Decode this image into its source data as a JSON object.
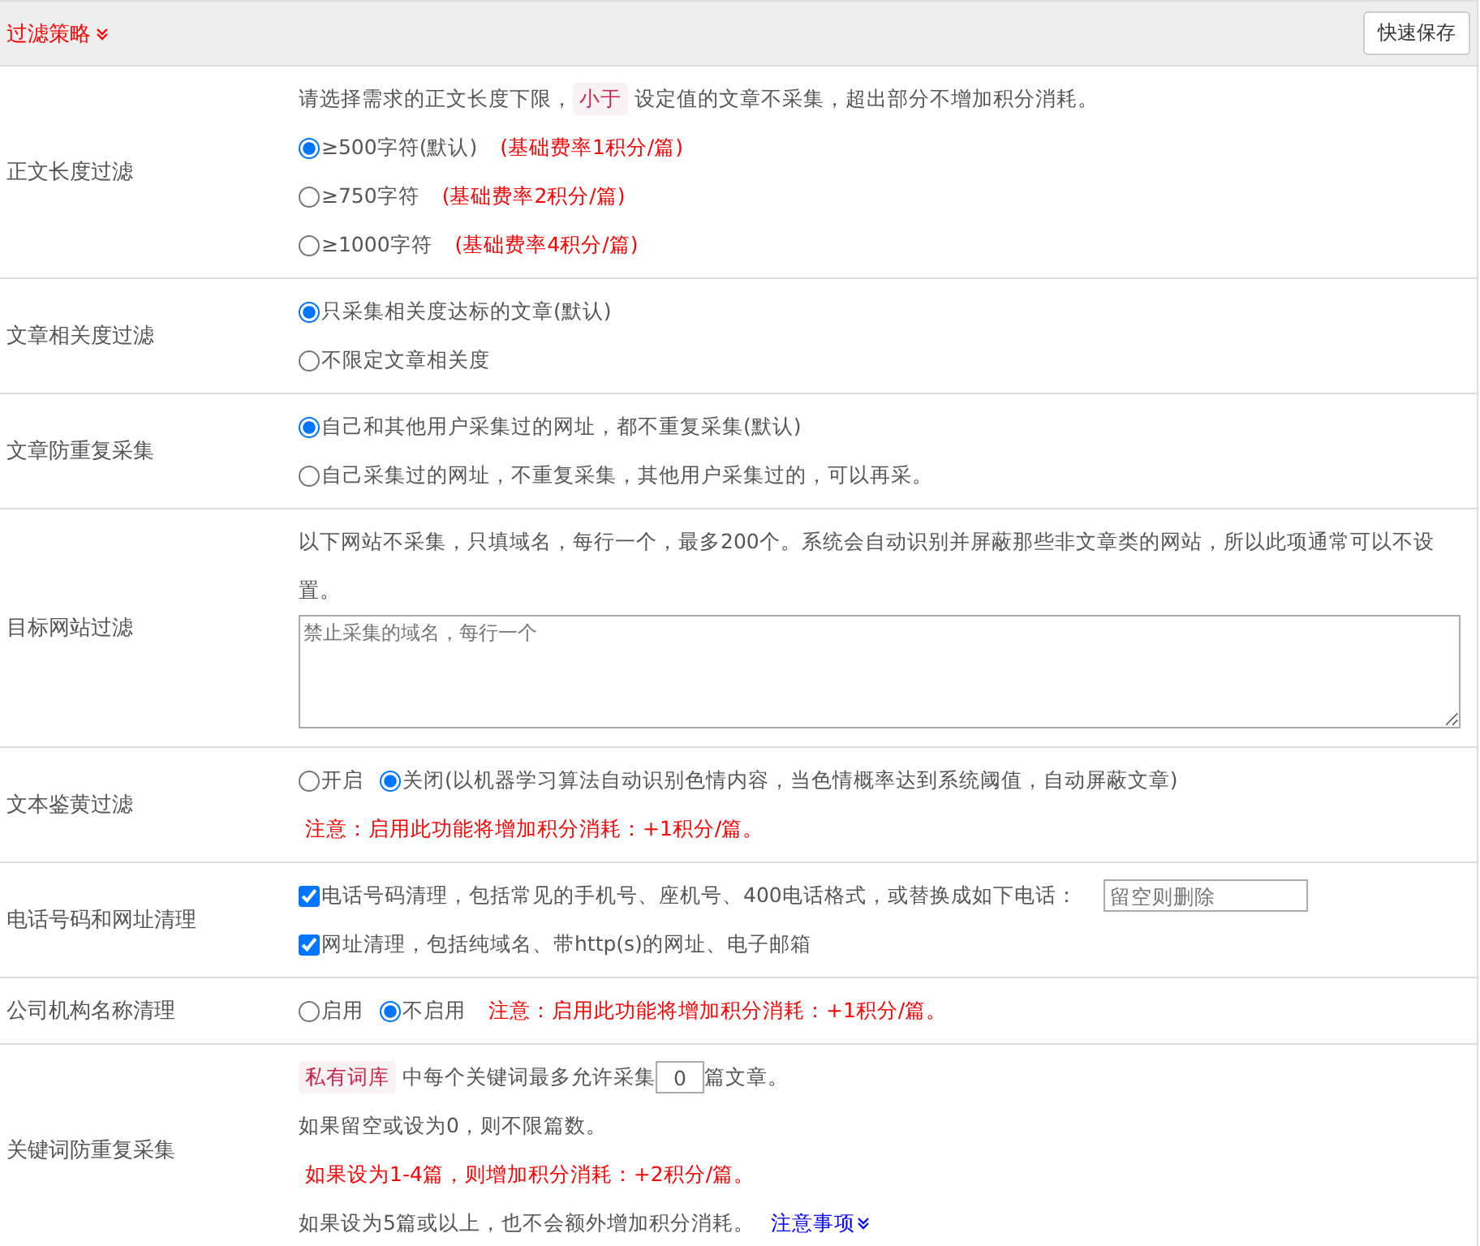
{
  "header": {
    "title": "过滤策略",
    "save_button": "快速保存"
  },
  "rows": [
    {
      "label": "正文长度过滤",
      "lines": [
        [
          {
            "kind": "text",
            "text": "请选择需求的正文长度下限，"
          },
          {
            "kind": "tag",
            "text": "小于"
          },
          {
            "kind": "text",
            "text": "设定值的文章不采集，超出部分不增加积分消耗。"
          }
        ],
        [
          {
            "kind": "radio",
            "text": "≥500字符(默认)",
            "selected": true
          },
          {
            "kind": "warn",
            "text": "(基础费率1积分/篇)"
          }
        ],
        [
          {
            "kind": "radio",
            "text": "≥750字符",
            "selected": false
          },
          {
            "kind": "warn",
            "text": "(基础费率2积分/篇)"
          }
        ],
        [
          {
            "kind": "radio",
            "text": "≥1000字符",
            "selected": false
          },
          {
            "kind": "warn",
            "text": "(基础费率4积分/篇)"
          }
        ]
      ]
    },
    {
      "label": "文章相关度过滤",
      "lines": [
        [
          {
            "kind": "radio",
            "text": "只采集相关度达标的文章(默认)",
            "selected": true
          }
        ],
        [
          {
            "kind": "radio",
            "text": "不限定文章相关度",
            "selected": false
          }
        ]
      ]
    },
    {
      "label": "文章防重复采集",
      "lines": [
        [
          {
            "kind": "radio",
            "text": "自己和其他用户采集过的网址，都不重复采集(默认)",
            "selected": true
          }
        ],
        [
          {
            "kind": "radio",
            "text": "自己采集过的网址，不重复采集，其他用户采集过的，可以再采。",
            "selected": false
          }
        ]
      ]
    },
    {
      "label": "目标网站过滤",
      "lines": [
        [
          {
            "kind": "text",
            "text": "以下网站不采集，只填域名，每行一个，最多200个。系统会自动识别并屏蔽那些非文章类的网站，所以此项通常可以不设置。"
          }
        ],
        [
          {
            "kind": "textarea",
            "placeholder": "禁止采集的域名，每行一个"
          }
        ]
      ]
    },
    {
      "label": "文本鉴黄过滤",
      "lines": [
        [
          {
            "kind": "radio",
            "text": "开启",
            "selected": false
          },
          {
            "kind": "radio",
            "text": "关闭(以机器学习算法自动识别色情内容，当色情概率达到系统阈值，自动屏蔽文章)",
            "selected": true
          }
        ],
        [
          {
            "kind": "warn",
            "text": "注意：启用此功能将增加积分消耗：+1积分/篇。"
          }
        ]
      ]
    },
    {
      "label": "电话号码和网址清理",
      "lines": [
        [
          {
            "kind": "checkbox",
            "text": "电话号码清理，包括常见的手机号、座机号、400电话格式，或替换成如下电话：",
            "checked": true
          },
          {
            "kind": "input",
            "placeholder": "留空则删除"
          }
        ],
        [
          {
            "kind": "checkbox",
            "text": "网址清理，包括纯域名、带http(s)的网址、电子邮箱",
            "checked": true
          }
        ]
      ]
    },
    {
      "label": "公司机构名称清理",
      "lines": [
        [
          {
            "kind": "radio",
            "text": "启用",
            "selected": false
          },
          {
            "kind": "radio",
            "text": "不启用",
            "selected": true
          },
          {
            "kind": "warn",
            "text": "注意：启用此功能将增加积分消耗：+1积分/篇。"
          }
        ]
      ]
    },
    {
      "label": "关键词防重复采集",
      "lines": [
        [
          {
            "kind": "tag",
            "text": "私有词库"
          },
          {
            "kind": "text",
            "text": "中每个关键词最多允许采集"
          },
          {
            "kind": "number",
            "value": "0"
          },
          {
            "kind": "text",
            "text": "篇文章。"
          }
        ],
        [
          {
            "kind": "text",
            "text": "如果留空或设为0，则不限篇数。"
          }
        ],
        [
          {
            "kind": "warn",
            "text": "如果设为1-4篇，则增加积分消耗：+2积分/篇。"
          }
        ],
        [
          {
            "kind": "text",
            "text": "如果设为5篇或以上，也不会额外增加积分消耗。"
          },
          {
            "kind": "link",
            "text": "注意事项"
          }
        ]
      ]
    }
  ]
}
